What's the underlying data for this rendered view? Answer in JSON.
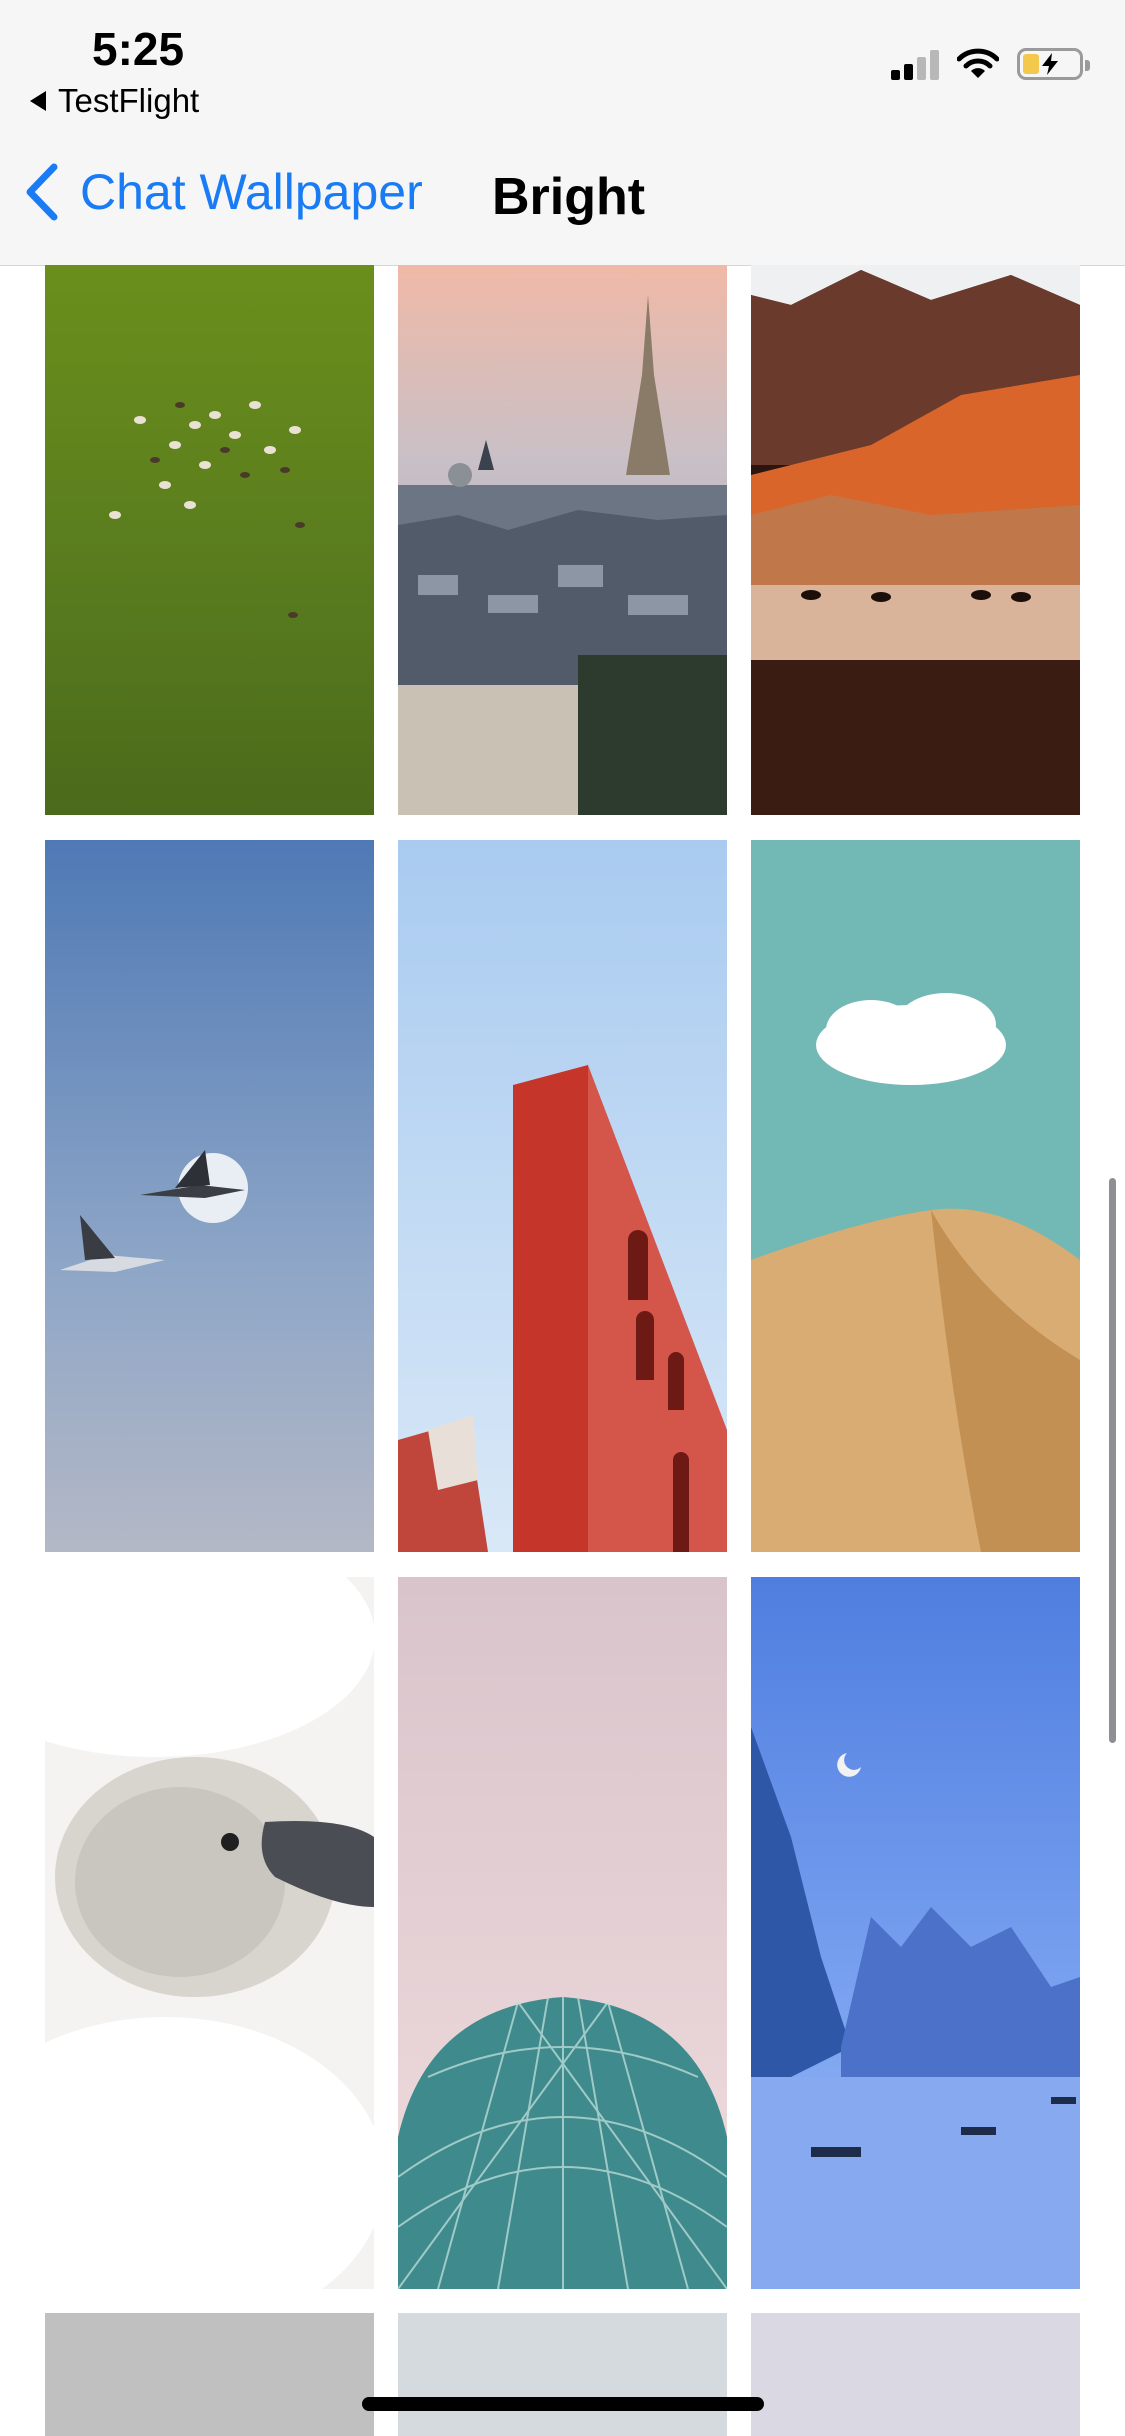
{
  "status_bar": {
    "time": "5:25",
    "back_app_label": "TestFlight",
    "icons": [
      "cellular-signal-icon",
      "wifi-icon",
      "battery-charging-icon"
    ]
  },
  "nav": {
    "back_label": "Chat Wallpaper",
    "title": "Bright",
    "accent_color": "#1a7cf5"
  },
  "wallpapers": [
    {
      "name": "green-field-animals"
    },
    {
      "name": "paris-eiffel-tower"
    },
    {
      "name": "mountain-yaks"
    },
    {
      "name": "cranes-moon"
    },
    {
      "name": "red-tower"
    },
    {
      "name": "cloud-desert"
    },
    {
      "name": "cygnet"
    },
    {
      "name": "glass-dome"
    },
    {
      "name": "blue-karst-river"
    },
    {
      "name": "gray-placeholder"
    },
    {
      "name": "light-placeholder"
    },
    {
      "name": "lavender-placeholder"
    }
  ]
}
